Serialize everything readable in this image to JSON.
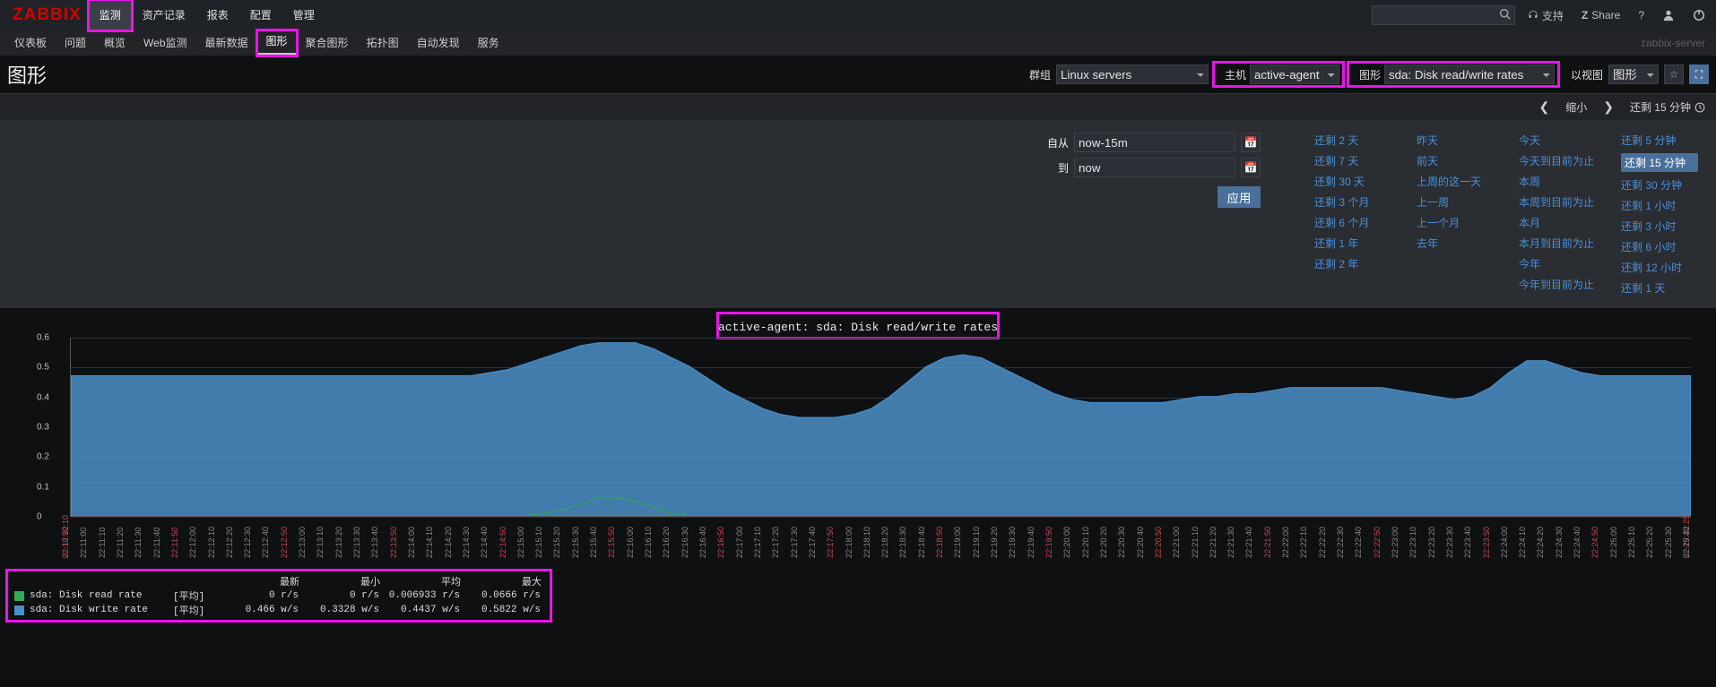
{
  "brand": "ZABBIX",
  "topnav": [
    "监测",
    "资产记录",
    "报表",
    "配置",
    "管理"
  ],
  "topnav_active": 0,
  "top_right": {
    "support": "支持",
    "share": "Share"
  },
  "subnav": [
    "仪表板",
    "问题",
    "概览",
    "Web监测",
    "最新数据",
    "图形",
    "聚合图形",
    "拓扑图",
    "自动发现",
    "服务"
  ],
  "subnav_active": 5,
  "server_name": "zabbix-server",
  "page_title": "图形",
  "filter": {
    "group_label": "群组",
    "group_value": "Linux servers",
    "host_label": "主机",
    "host_value": "active-agent",
    "graph_label": "图形",
    "graph_value": "sda: Disk read/write rates",
    "view_label": "以视图",
    "view_value": "图形"
  },
  "timerow": {
    "zoomout": "缩小",
    "status": "还剩 15 分钟"
  },
  "timepicker": {
    "from_label": "自从",
    "from_value": "now-15m",
    "to_label": "到",
    "to_value": "now",
    "apply": "应用",
    "col1": [
      "还剩 2 天",
      "还剩 7 天",
      "还剩 30 天",
      "还剩 3 个月",
      "还剩 6 个月",
      "还剩 1 年",
      "还剩 2 年"
    ],
    "col2": [
      "昨天",
      "前天",
      "上周的这一天",
      "上一周",
      "上一个月",
      "去年"
    ],
    "col3": [
      "今天",
      "今天到目前为止",
      "本周",
      "本周到目前为止",
      "本月",
      "本月到目前为止",
      "今年",
      "今年到目前为止"
    ],
    "col4": [
      "还剩 5 分钟",
      "还剩 15 分钟",
      "还剩 30 分钟",
      "还剩 1 小时",
      "还剩 3 小时",
      "还剩 6 小时",
      "还剩 12 小时",
      "还剩 1 天"
    ],
    "col4_selected": 1
  },
  "chart_data": {
    "type": "area",
    "title": "active-agent: sda: Disk read/write rates",
    "y_ticks": [
      0,
      0.1,
      0.2,
      0.3,
      0.4,
      0.5,
      0.6
    ],
    "ylim": [
      0,
      0.6
    ],
    "x_labels": [
      "22:10:50",
      "22:11:00",
      "22:11:10",
      "22:11:20",
      "22:11:30",
      "22:11:40",
      "22:11:50",
      "22:12:00",
      "22:12:10",
      "22:12:20",
      "22:12:30",
      "22:12:40",
      "22:12:50",
      "22:13:00",
      "22:13:10",
      "22:13:20",
      "22:13:30",
      "22:13:40",
      "22:13:50",
      "22:14:00",
      "22:14:10",
      "22:14:20",
      "22:14:30",
      "22:14:40",
      "22:14:50",
      "22:15:00",
      "22:15:10",
      "22:15:20",
      "22:15:30",
      "22:15:40",
      "22:15:50",
      "22:16:00",
      "22:16:10",
      "22:16:20",
      "22:16:30",
      "22:16:40",
      "22:16:50",
      "22:17:00",
      "22:17:10",
      "22:17:20",
      "22:17:30",
      "22:17:40",
      "22:17:50",
      "22:18:00",
      "22:18:10",
      "22:18:20",
      "22:18:30",
      "22:18:40",
      "22:18:50",
      "22:19:00",
      "22:19:10",
      "22:19:20",
      "22:19:30",
      "22:19:40",
      "22:19:50",
      "22:20:00",
      "22:20:10",
      "22:20:20",
      "22:20:30",
      "22:20:40",
      "22:20:50",
      "22:21:00",
      "22:21:10",
      "22:21:20",
      "22:21:30",
      "22:21:40",
      "22:21:50",
      "22:22:00",
      "22:22:10",
      "22:22:20",
      "22:22:30",
      "22:22:40",
      "22:22:50",
      "22:23:00",
      "22:23:10",
      "22:23:20",
      "22:23:30",
      "22:23:40",
      "22:23:50",
      "22:24:00",
      "22:24:10",
      "22:24:20",
      "22:24:30",
      "22:24:40",
      "22:24:50",
      "22:25:00",
      "22:25:10",
      "22:25:20",
      "22:25:30",
      "22:25:40"
    ],
    "x_highlight_every": 6,
    "x_edge_labels": [
      "02-17 22:10",
      "02-17 22:25"
    ],
    "series": [
      {
        "name": "sda: Disk write rate",
        "color": "#4a8fc8",
        "values": [
          0.47,
          0.47,
          0.47,
          0.47,
          0.47,
          0.47,
          0.47,
          0.47,
          0.47,
          0.47,
          0.47,
          0.47,
          0.47,
          0.47,
          0.47,
          0.47,
          0.47,
          0.47,
          0.47,
          0.47,
          0.47,
          0.47,
          0.47,
          0.48,
          0.49,
          0.51,
          0.53,
          0.55,
          0.57,
          0.58,
          0.58,
          0.58,
          0.56,
          0.53,
          0.5,
          0.46,
          0.42,
          0.39,
          0.36,
          0.34,
          0.33,
          0.33,
          0.33,
          0.34,
          0.36,
          0.4,
          0.45,
          0.5,
          0.53,
          0.54,
          0.53,
          0.5,
          0.47,
          0.44,
          0.41,
          0.39,
          0.38,
          0.38,
          0.38,
          0.38,
          0.38,
          0.39,
          0.4,
          0.4,
          0.41,
          0.41,
          0.42,
          0.43,
          0.43,
          0.43,
          0.43,
          0.43,
          0.43,
          0.42,
          0.41,
          0.4,
          0.39,
          0.4,
          0.43,
          0.48,
          0.52,
          0.52,
          0.5,
          0.48,
          0.47,
          0.47,
          0.47,
          0.47,
          0.47,
          0.47
        ]
      },
      {
        "name": "sda: Disk read rate",
        "color": "#33aa55",
        "values": [
          0,
          0,
          0,
          0,
          0,
          0,
          0,
          0,
          0,
          0,
          0,
          0,
          0,
          0,
          0,
          0,
          0,
          0,
          0,
          0,
          0,
          0,
          0,
          0,
          0,
          0,
          0.01,
          0.02,
          0.04,
          0.06,
          0.06,
          0.05,
          0.03,
          0.01,
          0,
          0,
          0,
          0,
          0,
          0,
          0,
          0,
          0,
          0,
          0,
          0,
          0,
          0,
          0,
          0,
          0,
          0,
          0,
          0,
          0,
          0,
          0,
          0,
          0,
          0,
          0,
          0,
          0,
          0,
          0,
          0,
          0,
          0,
          0,
          0,
          0,
          0,
          0,
          0,
          0,
          0,
          0,
          0,
          0,
          0,
          0,
          0,
          0,
          0,
          0,
          0,
          0,
          0,
          0,
          0
        ]
      }
    ]
  },
  "legend": {
    "headers": [
      "最新",
      "最小",
      "平均",
      "最大"
    ],
    "agg": "[平均]",
    "rows": [
      {
        "name": "sda: Disk read rate",
        "color": "#33aa55",
        "last": "0 r/s",
        "min": "0 r/s",
        "avg": "0.006933 r/s",
        "max": "0.0666 r/s"
      },
      {
        "name": "sda: Disk write rate",
        "color": "#4a8fc8",
        "last": "0.466 w/s",
        "min": "0.3328 w/s",
        "avg": "0.4437 w/s",
        "max": "0.5822 w/s"
      }
    ]
  }
}
